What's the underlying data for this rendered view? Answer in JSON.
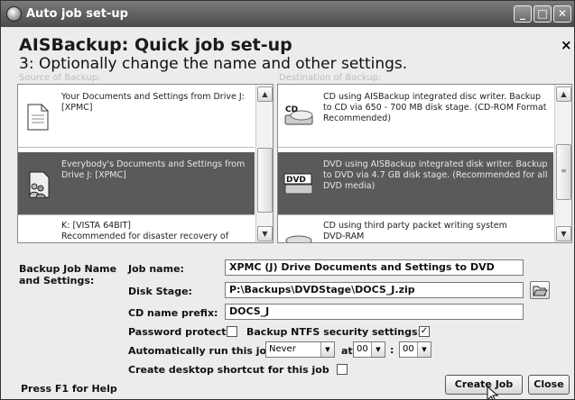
{
  "window": {
    "title": "Auto job set-up"
  },
  "header": {
    "title": "AISBackup: Quick job set-up",
    "subtitle": "3: Optionally change the name and other settings.",
    "source_label": "Source of Backup:",
    "destination_label": "Destination of Backup:"
  },
  "source_items": [
    {
      "text": "Your Documents and Settings from Drive J: [XPMC]",
      "icon": "document-icon",
      "selected": false
    },
    {
      "text": "Everybody's Documents and Settings from Drive J: [XPMC]",
      "icon": "users-document-icon",
      "selected": true
    },
    {
      "text": "K: [VISTA 64BIT]\nRecommended for disaster recovery of",
      "icon": "drive-icon",
      "selected": false
    }
  ],
  "destination_items": [
    {
      "text": "CD using AISBackup integrated disc writer. Backup to CD via 650 - 700 MB disk stage. (CD-ROM Format Recommended)",
      "icon": "cd-drive-icon",
      "icon_label": "CD",
      "selected": false
    },
    {
      "text": "DVD using AISBackup integrated disk writer. Backup to DVD via 4.7 GB disk stage. (Recommended for all DVD media)",
      "icon": "dvd-drive-icon",
      "icon_label": "DVD",
      "selected": true
    },
    {
      "text": "CD using third party packet writing system\nDVD-RAM",
      "icon": "drive-icon",
      "selected": false
    }
  ],
  "form": {
    "section_label": "Backup Job Name and Settings:",
    "job_name_label": "Job name:",
    "job_name_value": "XPMC (J) Drive Documents and Settings to DVD",
    "disk_stage_label": "Disk Stage:",
    "disk_stage_value": "P:\\Backups\\DVDStage\\DOCS_J.zip",
    "cd_prefix_label": "CD name prefix:",
    "cd_prefix_value": "DOCS_J",
    "password_label": "Password protect:",
    "password_checked": false,
    "ntfs_label": "Backup NTFS security settings:",
    "ntfs_checked": true,
    "autorun_label": "Automatically run this job",
    "autorun_value": "Never",
    "at_label": "at",
    "hour_value": "00",
    "colon": ":",
    "minute_value": "00",
    "shortcut_label": "Create desktop shortcut for this job",
    "shortcut_checked": false
  },
  "footer": {
    "help_text": "Press F1 for Help",
    "create_button": "Create Job",
    "close_button": "Close"
  },
  "colors": {
    "selected_row": "#5a5a5a",
    "titlebar": "#5c5c5c"
  }
}
